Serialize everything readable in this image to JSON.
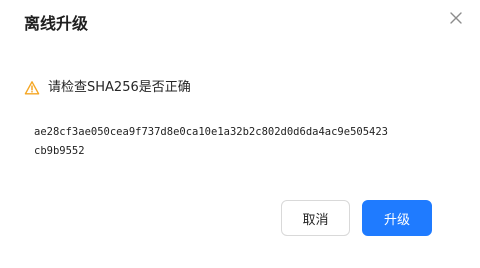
{
  "dialog": {
    "title": "离线升级",
    "warning_text": "请检查SHA256是否正确",
    "hash_lines": [
      "ae28cf3ae050cea9f737d8e0ca10e1a32b2c802d0d6da4ac9e505423",
      "cb9b9552"
    ],
    "cancel_label": "取消",
    "confirm_label": "升级",
    "icons": {
      "close": "close-icon",
      "warning": "warning-triangle-icon"
    },
    "colors": {
      "primary": "#1f7bff",
      "warning": "#f5a623"
    }
  }
}
